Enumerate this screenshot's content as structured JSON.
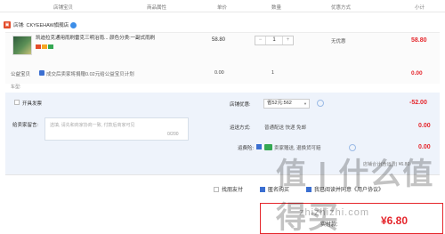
{
  "header": {
    "columns": [
      "店铺宝贝",
      "商品属性",
      "单价",
      "数量",
      "优惠方式",
      "小计"
    ]
  },
  "store": {
    "label": "店铺:",
    "name": "CKYEEHAW旗舰店"
  },
  "item": {
    "title": "凯迪拉克通用雨刷雷克三明治雨... 颜色分类:一副式雨刷",
    "price": "58.80",
    "qty": "1",
    "qty_minus": "−",
    "qty_plus": "+",
    "promo": "无优惠",
    "subtotal": "58.80"
  },
  "insurance": {
    "label": "公益宝贝",
    "text": "成交后卖家将捐赠0.02元给公益宝贝计划",
    "price": "0.00",
    "qty": "1",
    "subtotal": "0.00"
  },
  "car_type_label": "车型:",
  "anonymous_label": "开具发票",
  "message": {
    "label": "给卖家留言:",
    "placeholder": "选填, 请先和商家协商一致, 付款后商家可见",
    "count": "0/200"
  },
  "discount": {
    "label": "店铺优惠:",
    "value": "省52元:562",
    "amount": "-52.00"
  },
  "shipping": {
    "label": "运送方式:",
    "value": "普通配送 快递 免邮",
    "amount": "0.00"
  },
  "freight_ins": {
    "label": "运费险:",
    "value": "卖家赠送, 退换货可赔",
    "amount": "0.00"
  },
  "store_total_text": "店铺合计(含运费) ¥6.80",
  "options": {
    "friend_pay": "找朋友付",
    "anonymous": "匿名购买",
    "other": "我已阅读并同意《用户协议》"
  },
  "total": {
    "label": "实付款:",
    "amount": "¥6.80"
  },
  "watermark": {
    "big": "值 | 什么值得买",
    "url": "zhizhizhi.com"
  },
  "colors": {
    "accent_red": "#e5262c",
    "brand_blue": "#3b6fd1"
  }
}
